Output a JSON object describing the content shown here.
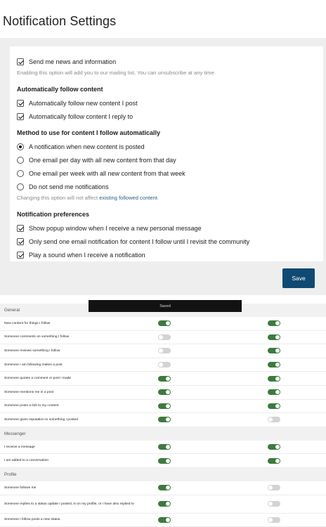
{
  "page_title": "Notification Settings",
  "news": {
    "label": "Send me news and information",
    "checked": true,
    "help": "Enabling this option will add you to our mailing list. You can unsubscribe at any time."
  },
  "auto_follow": {
    "title": "Automatically follow content",
    "options": [
      {
        "label": "Automatically follow new content I post",
        "checked": true
      },
      {
        "label": "Automatically follow content I reply to",
        "checked": true
      }
    ]
  },
  "method": {
    "title": "Method to use for content I follow automatically",
    "options": [
      {
        "label": "A notification when new content is posted",
        "selected": true
      },
      {
        "label": "One email per day with all new content from that day",
        "selected": false
      },
      {
        "label": "One email per week with all new content from that week",
        "selected": false
      },
      {
        "label": "Do not send me notifications",
        "selected": false
      }
    ],
    "help_prefix": "Changing this option will not affect ",
    "help_link": "existing followed content",
    "help_suffix": "."
  },
  "preferences": {
    "title": "Notification preferences",
    "options": [
      {
        "label": "Show popup window when I receive a new personal message",
        "checked": true
      },
      {
        "label": "Only send one email notification for content I follow until I revisit the community",
        "checked": true
      },
      {
        "label": "Play a sound when I receive a notification",
        "checked": true
      }
    ]
  },
  "save_label": "Save",
  "toast_text": "Saved",
  "sections": [
    {
      "title": "General",
      "items": [
        {
          "label": "New content for things I follow",
          "col1": true,
          "col2": true
        },
        {
          "label": "Someone comments on something I follow",
          "col1": false,
          "col2": true
        },
        {
          "label": "Someone reviews something I follow",
          "col1": false,
          "col2": true
        },
        {
          "label": "Someone I am following makes a post",
          "col1": false,
          "col2": true
        },
        {
          "label": "Someone quotes a comment or post I made",
          "col1": true,
          "col2": true
        },
        {
          "label": "Someone mentions me in a post",
          "col1": true,
          "col2": true
        },
        {
          "label": "Someone posts a link to my content",
          "col1": true,
          "col2": true
        },
        {
          "label": "Someone gives reputation to something I posted",
          "col1": true,
          "col2": false
        }
      ]
    },
    {
      "title": "Messenger",
      "items": [
        {
          "label": "I receive a message",
          "col1": true,
          "col2": true
        },
        {
          "label": "I am added to a conversation",
          "col1": true,
          "col2": true
        }
      ]
    },
    {
      "title": "Profile",
      "items": [
        {
          "label": "Someone follows me",
          "col1": true,
          "col2": false
        },
        {
          "label": "Someone replies to a status update I posted, is on my profile, or I have also replied to",
          "col1": true,
          "col2": false,
          "tall": true
        },
        {
          "label": "Someone I follow posts a new status.",
          "col1": true,
          "col2": false
        }
      ]
    }
  ]
}
